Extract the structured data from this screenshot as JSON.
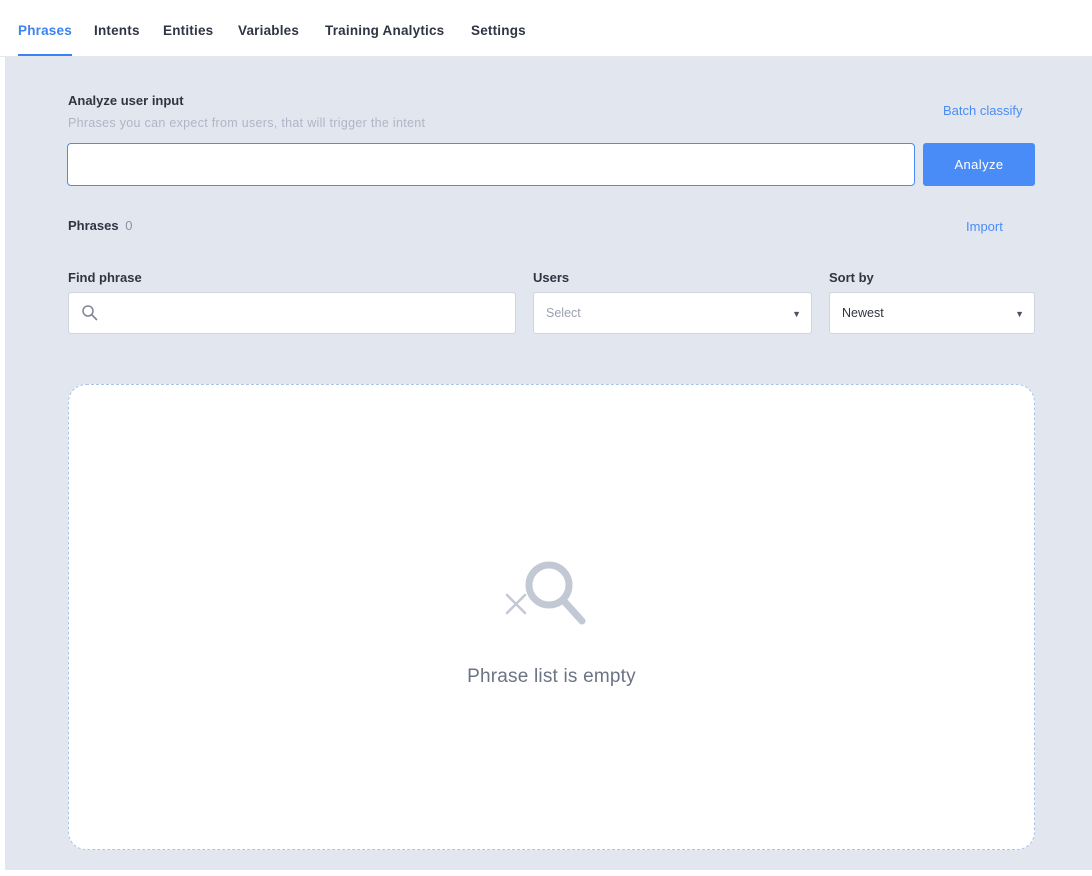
{
  "tabs": [
    {
      "label": "Phrases",
      "active": true
    },
    {
      "label": "Intents",
      "active": false
    },
    {
      "label": "Entities",
      "active": false
    },
    {
      "label": "Variables",
      "active": false
    },
    {
      "label": "Training Analytics",
      "active": false
    },
    {
      "label": "Settings",
      "active": false
    }
  ],
  "analyze": {
    "title": "Analyze user input",
    "subtitle": "Phrases you can expect from users, that will trigger the intent",
    "batch_label": "Batch classify",
    "input_value": "",
    "button_label": "Analyze"
  },
  "phrases": {
    "label": "Phrases",
    "count": "0",
    "import_label": "Import"
  },
  "filters": {
    "find": {
      "label": "Find phrase",
      "value": "",
      "icon": "search-icon"
    },
    "users": {
      "label": "Users",
      "placeholder": "Select"
    },
    "sort": {
      "label": "Sort by",
      "value": "Newest"
    }
  },
  "empty_state": {
    "icon": "search-x-icon",
    "text": "Phrase list is empty"
  },
  "colors": {
    "accent": "#4a8cf7",
    "background": "#e2e6ee",
    "text": "#2f3542",
    "muted": "#aeb6c6"
  }
}
